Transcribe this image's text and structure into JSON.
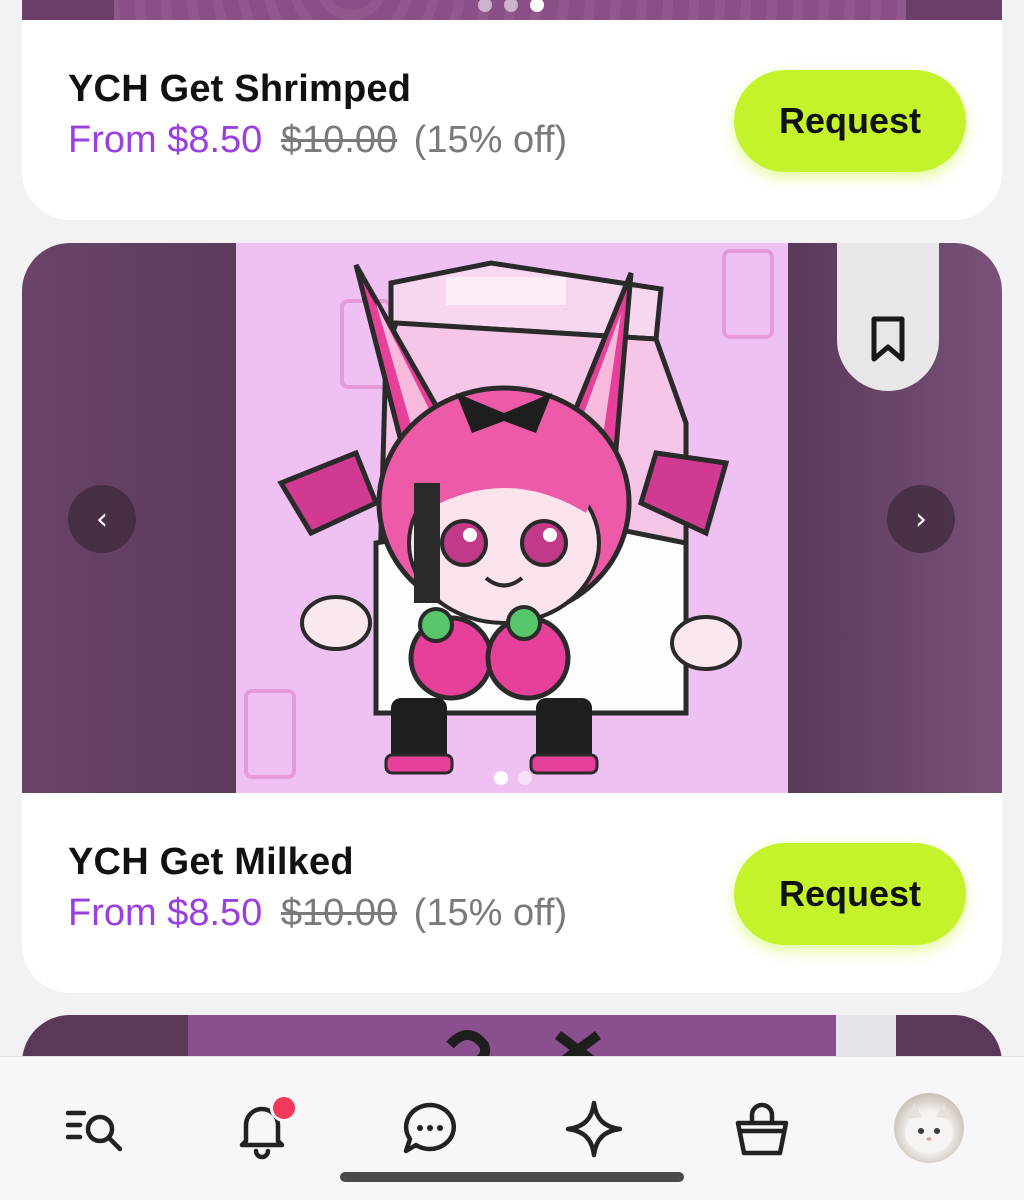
{
  "listings": [
    {
      "title": "YCH Get Shrimped",
      "price_from": "From $8.50",
      "price_original": "$10.00",
      "discount": "(15% off)",
      "request_label": "Request"
    },
    {
      "title": "YCH Get Milked",
      "price_from": "From $8.50",
      "price_original": "$10.00",
      "discount": "(15% off)",
      "request_label": "Request",
      "carousel_prev": "‹",
      "carousel_next": "›",
      "bookmark_icon": "bookmark-icon"
    }
  ],
  "bottom_nav": {
    "items": [
      {
        "icon": "search-list-icon"
      },
      {
        "icon": "bell-icon",
        "has_notification": true
      },
      {
        "icon": "chat-icon"
      },
      {
        "icon": "sparkle-icon"
      },
      {
        "icon": "shopping-bag-icon"
      },
      {
        "icon": "avatar"
      }
    ]
  },
  "colors": {
    "accent_price": "#9a3fe0",
    "request_button": "#c4f32b",
    "notification_dot": "#f0395a"
  }
}
